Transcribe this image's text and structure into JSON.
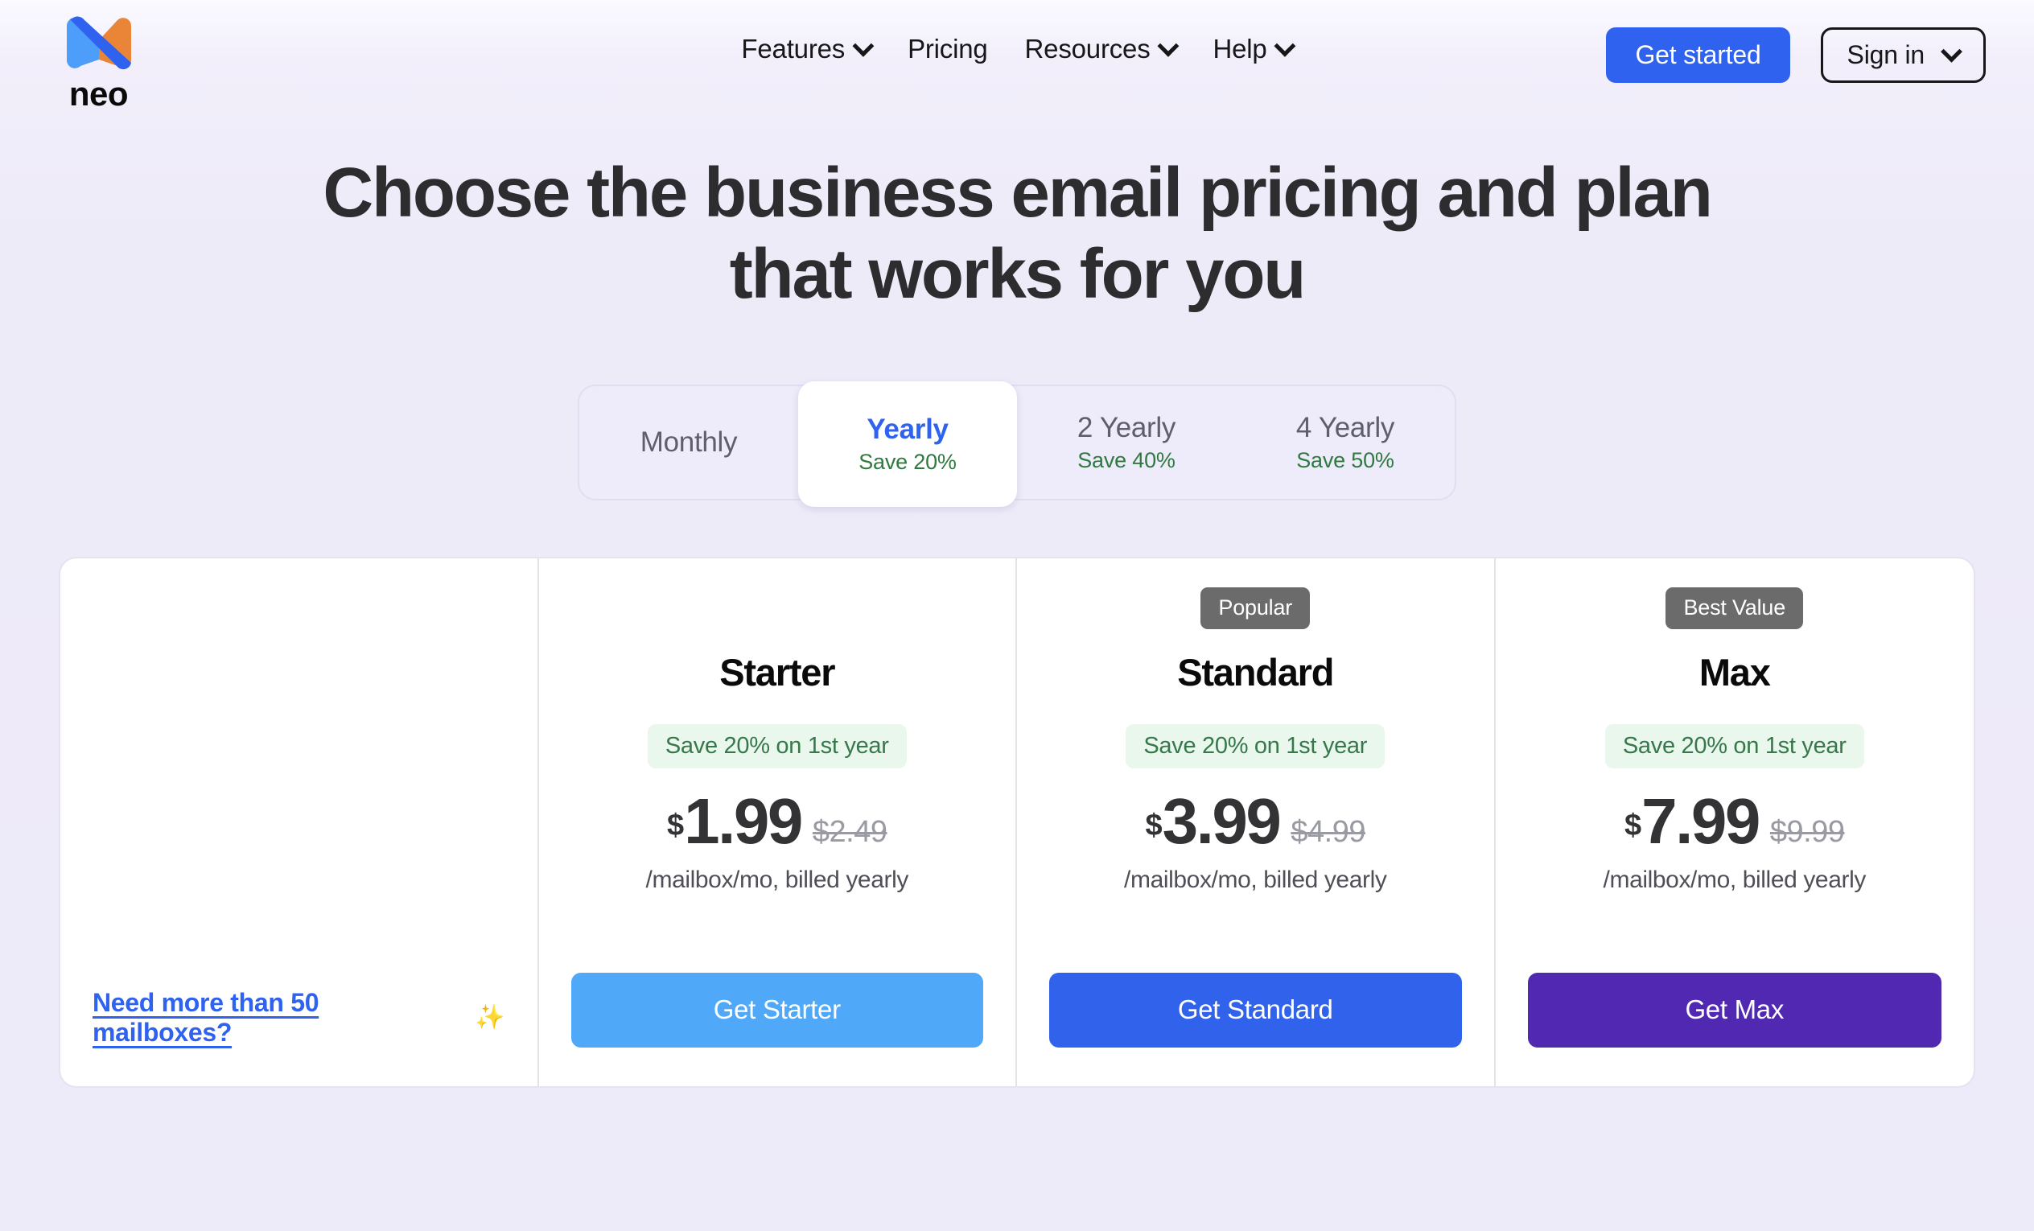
{
  "brand": {
    "name": "neo",
    "logo_icon": "neo-logo-icon",
    "colors": {
      "light_blue": "#4d9dfb",
      "blue": "#2f62ef",
      "orange": "#ea8537"
    }
  },
  "nav": {
    "items": [
      {
        "label": "Features",
        "has_dropdown": true
      },
      {
        "label": "Pricing",
        "has_dropdown": false
      },
      {
        "label": "Resources",
        "has_dropdown": true
      },
      {
        "label": "Help",
        "has_dropdown": true
      }
    ],
    "get_started_label": "Get started",
    "sign_in_label": "Sign in"
  },
  "hero": {
    "title": "Choose the business email pricing and plan that works for you"
  },
  "billing_toggle": {
    "selected": "Yearly",
    "options": [
      {
        "label": "Monthly",
        "save": ""
      },
      {
        "label": "Yearly",
        "save": "Save 20%",
        "active": true
      },
      {
        "label": "2 Yearly",
        "save": "Save 40%"
      },
      {
        "label": "4 Yearly",
        "save": "Save 50%"
      }
    ]
  },
  "info_column": {
    "more_mailboxes_link": "Need more than 50 mailboxes?",
    "sparkle_icon": "✨"
  },
  "plans": [
    {
      "badge": "",
      "name": "Starter",
      "save_pill": "Save 20% on 1st year",
      "currency": "$",
      "price": "1.99",
      "price_old": "$2.49",
      "price_note": "/mailbox/mo, billed yearly",
      "cta_label": "Get Starter",
      "cta_color": "#4fa9f8"
    },
    {
      "badge": "Popular",
      "name": "Standard",
      "save_pill": "Save 20% on 1st year",
      "currency": "$",
      "price": "3.99",
      "price_old": "$4.99",
      "price_note": "/mailbox/mo, billed yearly",
      "cta_label": "Get Standard",
      "cta_color": "#3162ec"
    },
    {
      "badge": "Best Value",
      "name": "Max",
      "save_pill": "Save 20% on 1st year",
      "currency": "$",
      "price": "7.99",
      "price_old": "$9.99",
      "price_note": "/mailbox/mo, billed yearly",
      "cta_label": "Get Max",
      "cta_color": "#5128b2"
    }
  ]
}
